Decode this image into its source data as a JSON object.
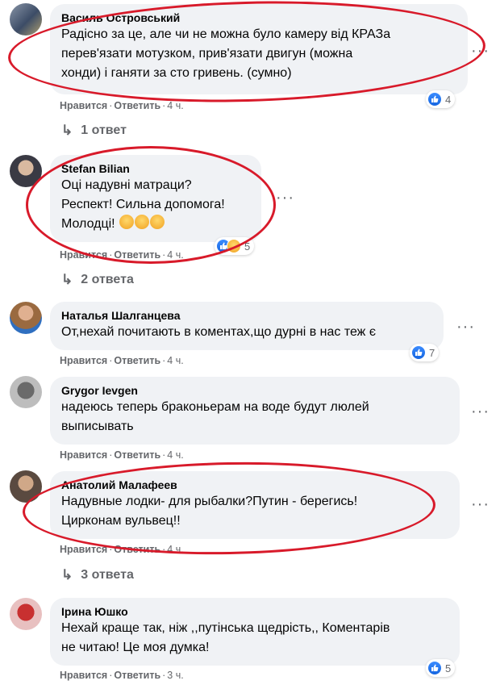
{
  "comments": [
    {
      "author": "Василь Островський",
      "text": "Радісно за це, але чи не можна було камеру від КРАЗа\nперев'язати мотузком, прив'язати двигун (можна\nхонди) і ганяти за сто гривень. (сумно)",
      "like_label": "Нравится",
      "reply_label": "Ответить",
      "time": "4 ч.",
      "reactions": {
        "count": "4",
        "icons": [
          "like-icon"
        ]
      },
      "replies_label": "1 ответ"
    },
    {
      "author": "Stefan Bilian",
      "text": "Оці надувні матраци?\nРеспект! Сильна допомога!\nМолодці!",
      "emoji_count": 3,
      "like_label": "Нравится",
      "reply_label": "Ответить",
      "time": "4 ч.",
      "reactions": {
        "count": "5",
        "icons": [
          "like-icon",
          "haha-icon"
        ]
      },
      "replies_label": "2 ответа"
    },
    {
      "author": "Наталья Шалганцева",
      "text": "От,нехай почитають в коментах,що дурні в нас теж є",
      "like_label": "Нравится",
      "reply_label": "Ответить",
      "time": "4 ч.",
      "reactions": {
        "count": "7",
        "icons": [
          "like-icon"
        ]
      }
    },
    {
      "author": "Grygor Ievgen",
      "text": "надеюсь теперь браконьерам на воде будут люлей\nвыписывать",
      "like_label": "Нравится",
      "reply_label": "Ответить",
      "time": "4 ч."
    },
    {
      "author": "Анатолий Малафеев",
      "text": "Надувные лодки- для рыбалки?Путин - берегись!\nЦирконам вульвец!!",
      "like_label": "Нравится",
      "reply_label": "Ответить",
      "time": "4 ч.",
      "replies_label": "3 ответа"
    },
    {
      "author": "Ірина Юшко",
      "text": "Нехай краще так, ніж ,,путінська щедрість,, Коментарів\nне читаю! Це моя думка!",
      "like_label": "Нравится",
      "reply_label": "Ответить",
      "time": "3 ч.",
      "reactions": {
        "count": "5",
        "icons": [
          "like-icon"
        ]
      }
    }
  ],
  "colors": {
    "bubble": "#f0f2f5",
    "meta_text": "#65676b",
    "highlight_ellipse": "#d81a2a",
    "like_blue": "#1877f2"
  },
  "icons": {
    "more": "more-options-icon",
    "reply_arrow": "reply-arrow-icon",
    "like": "like-icon",
    "haha": "haha-icon",
    "emoji": "grinning-face-icon"
  }
}
